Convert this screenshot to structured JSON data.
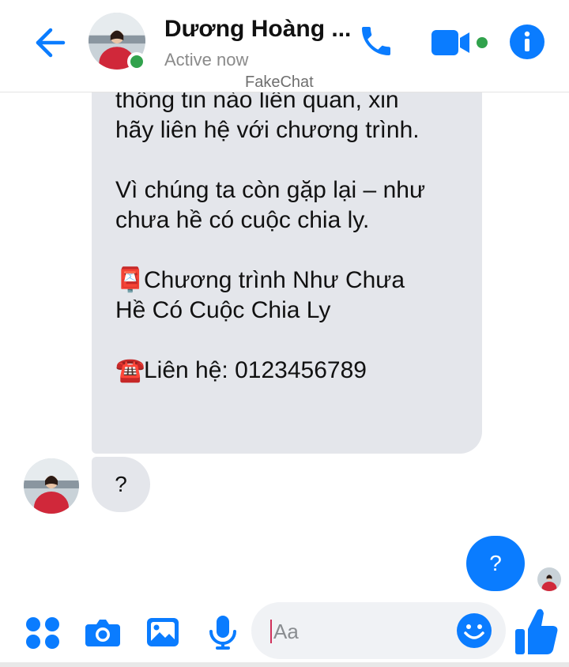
{
  "header": {
    "contact_name": "Dương Hoàng ...",
    "status": "Active now",
    "watermark": "FakeChat"
  },
  "messages": {
    "long_bubble": {
      "line1": "thông tin nào liên quan, xin",
      "line2": "hãy liên hệ với chương trình.",
      "line3": "Vì chúng ta còn gặp lại – như",
      "line4": "chưa hề có cuộc chia ly.",
      "program_icon": "📮",
      "line5": "Chương trình Như Chưa",
      "line6": "Hề Có Cuộc Chia Ly",
      "phone_icon": "☎️",
      "line7": "Liên hệ: 0123456789"
    },
    "incoming_short": "?",
    "outgoing_short": "?"
  },
  "composer": {
    "placeholder": "Aa"
  },
  "colors": {
    "accent": "#0a7cff",
    "online": "#31a24c",
    "bubble_in": "#e4e6eb"
  },
  "icons": [
    "back-arrow-icon",
    "phone-icon",
    "video-camera-icon",
    "info-icon",
    "apps-grid-icon",
    "camera-icon",
    "image-icon",
    "microphone-icon",
    "smiley-icon",
    "thumbs-up-icon"
  ]
}
